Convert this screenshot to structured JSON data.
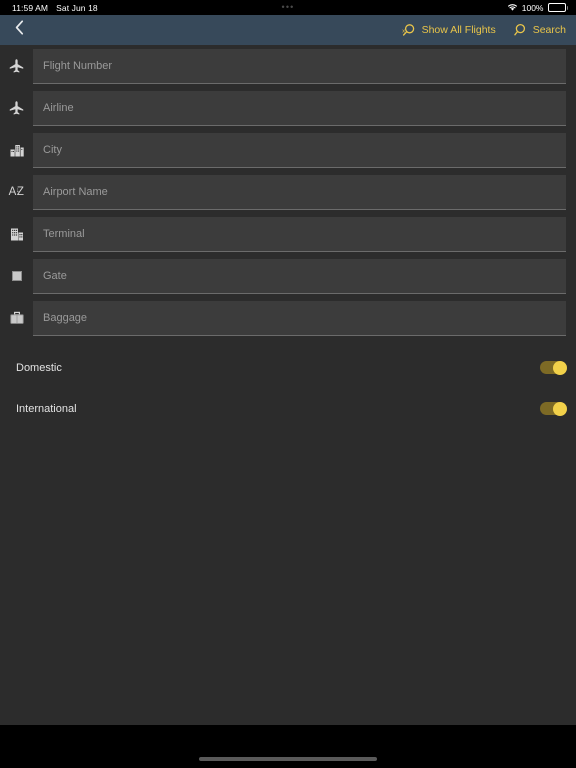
{
  "status_bar": {
    "time": "11:59 AM",
    "date": "Sat Jun 18",
    "center_dots": "•••",
    "wifi_icon": "wifi-icon",
    "battery_percent": "100%",
    "battery_icon": "battery-full-icon"
  },
  "navbar": {
    "background_color": "#37495a",
    "accent_color": "#e9c54a",
    "back_icon": "chevron-left-icon",
    "actions": [
      {
        "label": "Show All Flights",
        "icon": "search-clear-icon"
      },
      {
        "label": "Search",
        "icon": "search-icon"
      }
    ]
  },
  "form": {
    "fields": [
      {
        "placeholder": "Flight Number",
        "icon": "airplane-icon"
      },
      {
        "placeholder": "Airline",
        "icon": "airplane-icon"
      },
      {
        "placeholder": "City",
        "icon": "city-buildings-icon"
      },
      {
        "placeholder": "Airport Name",
        "icon": "sort-az-icon"
      },
      {
        "placeholder": "Terminal",
        "icon": "terminal-building-icon"
      },
      {
        "placeholder": "Gate",
        "icon": "gate-square-icon"
      },
      {
        "placeholder": "Baggage",
        "icon": "briefcase-icon"
      }
    ],
    "toggles": [
      {
        "label": "Domestic",
        "value": "on"
      },
      {
        "label": "International",
        "value": "on"
      }
    ]
  },
  "colors": {
    "content_background": "#2c2c2c",
    "field_background": "#3c3c3c",
    "field_underline": "#6b6b6b",
    "placeholder_text": "#9a9a9a",
    "toggle_on_track": "#7d6a25",
    "toggle_on_knob": "#f2d14a"
  },
  "home_indicator": "home-indicator-bar"
}
